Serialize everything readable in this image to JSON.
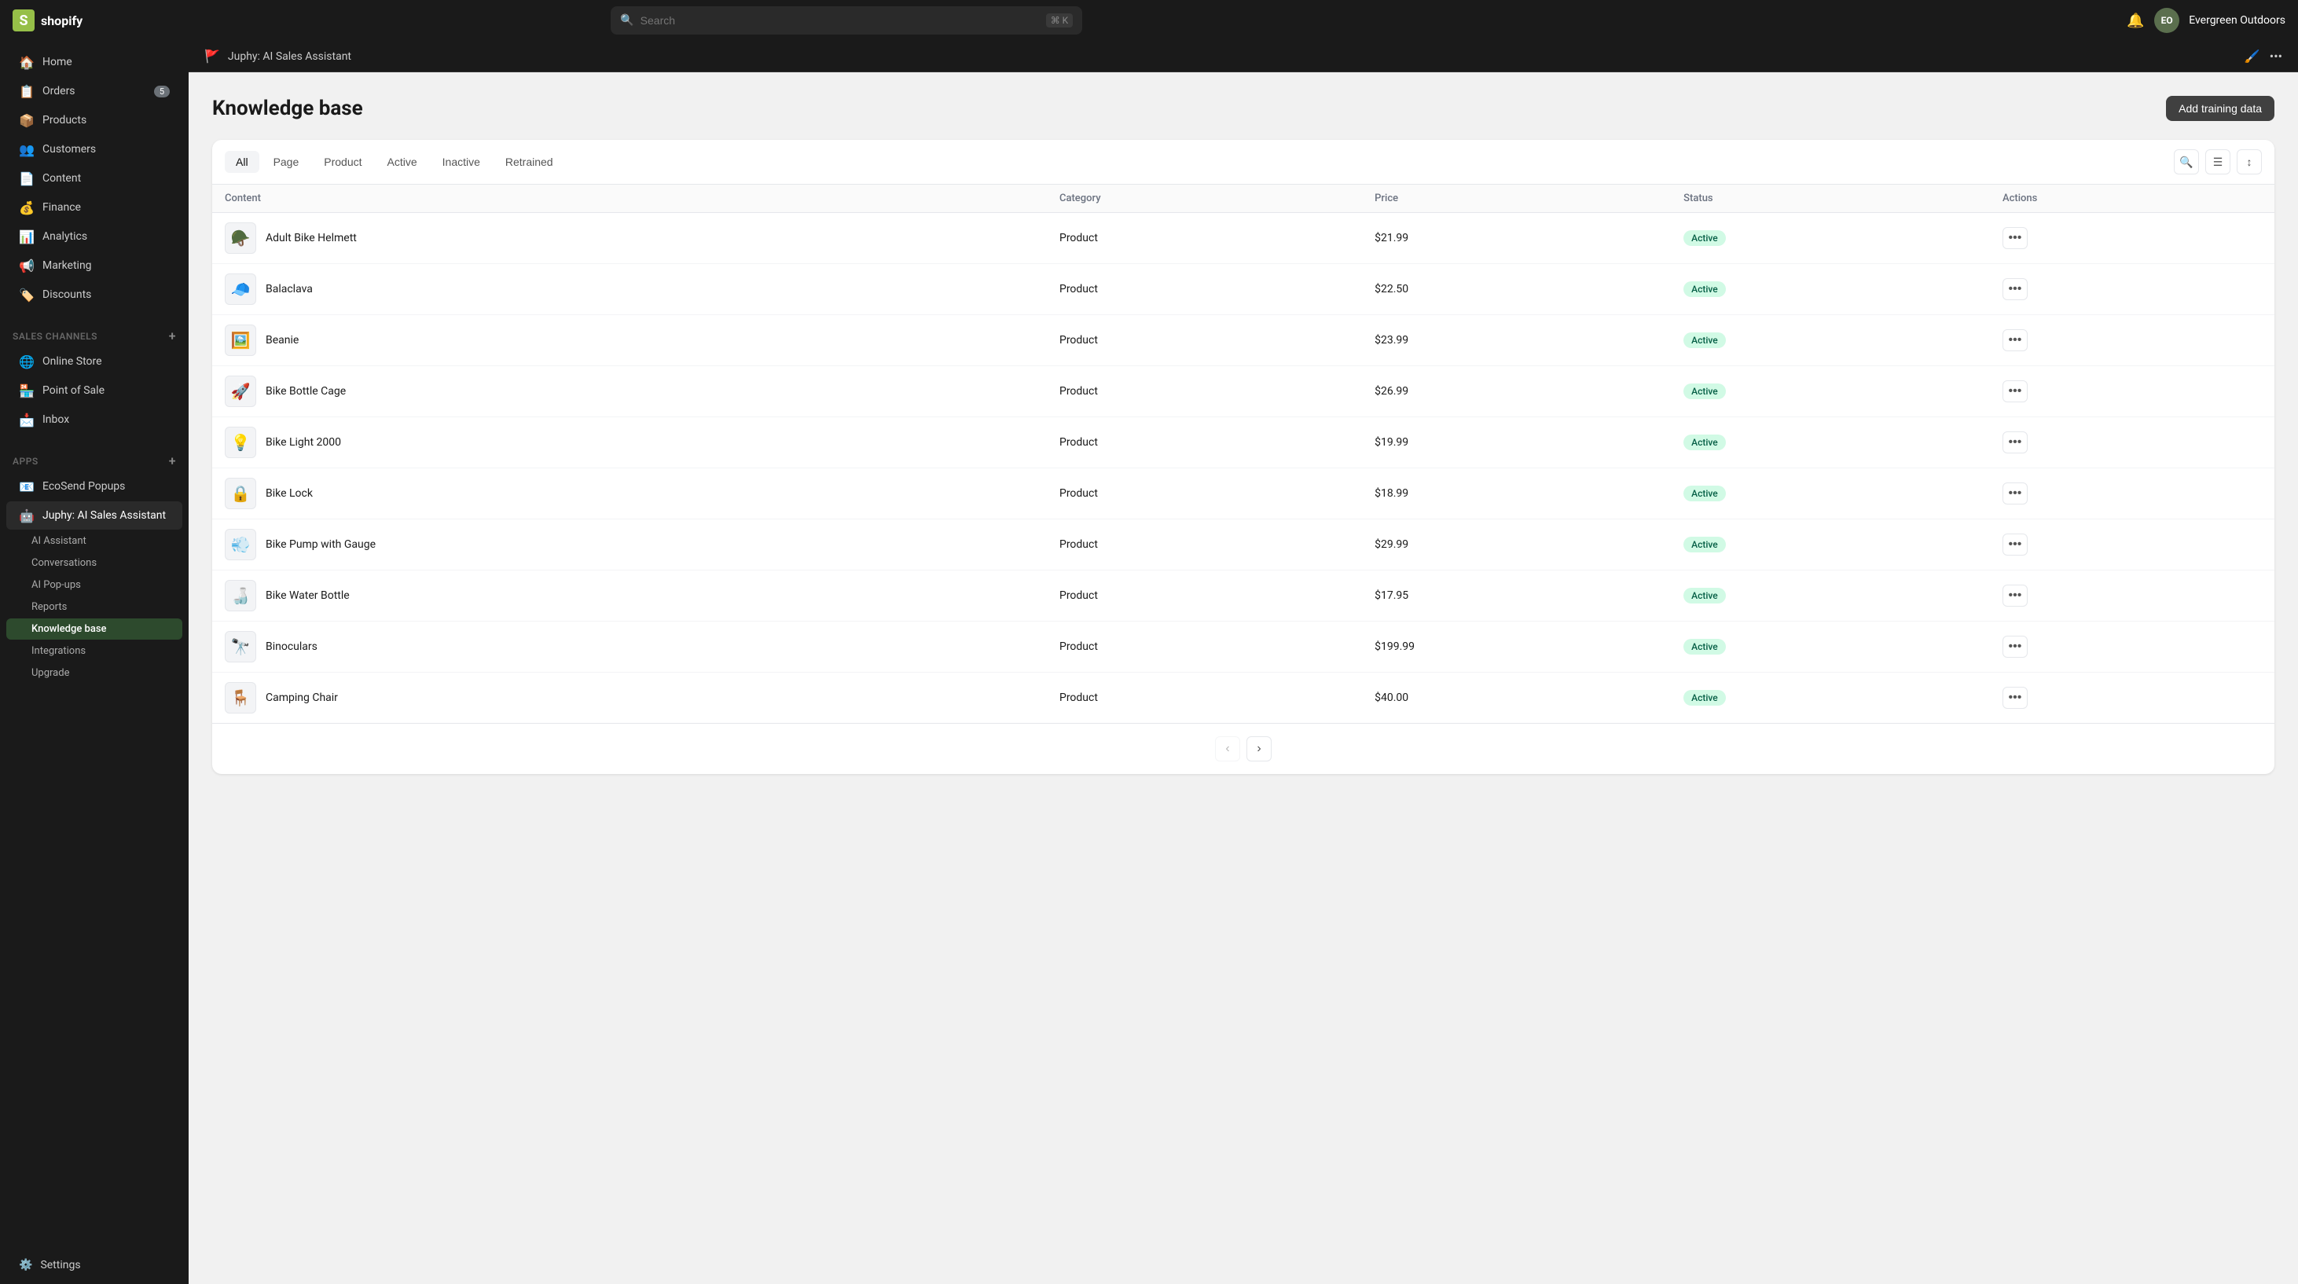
{
  "topbar": {
    "logo_text": "shopify",
    "search_placeholder": "Search",
    "search_shortcut": "⌘ K",
    "avatar_initials": "EO",
    "store_name": "Evergreen Outdoors"
  },
  "sidebar": {
    "main_items": [
      {
        "id": "home",
        "label": "Home",
        "icon": "🏠",
        "badge": null
      },
      {
        "id": "orders",
        "label": "Orders",
        "icon": "📋",
        "badge": "5"
      },
      {
        "id": "products",
        "label": "Products",
        "icon": "📦",
        "badge": null
      },
      {
        "id": "customers",
        "label": "Customers",
        "icon": "👥",
        "badge": null
      },
      {
        "id": "content",
        "label": "Content",
        "icon": "📄",
        "badge": null
      },
      {
        "id": "finance",
        "label": "Finance",
        "icon": "💰",
        "badge": null
      },
      {
        "id": "analytics",
        "label": "Analytics",
        "icon": "📊",
        "badge": null
      },
      {
        "id": "marketing",
        "label": "Marketing",
        "icon": "📢",
        "badge": null
      },
      {
        "id": "discounts",
        "label": "Discounts",
        "icon": "🏷️",
        "badge": null
      }
    ],
    "sales_channels_label": "Sales channels",
    "sales_channels": [
      {
        "id": "online-store",
        "label": "Online Store",
        "icon": "🌐"
      },
      {
        "id": "point-of-sale",
        "label": "Point of Sale",
        "icon": "🏪"
      },
      {
        "id": "inbox",
        "label": "Inbox",
        "icon": "📩"
      }
    ],
    "apps_label": "Apps",
    "apps": [
      {
        "id": "ecosend",
        "label": "EcoSend Popups",
        "icon": "📧"
      },
      {
        "id": "juphy",
        "label": "Juphy: AI Sales Assistant",
        "icon": "🤖",
        "active": true
      }
    ],
    "sub_items": [
      {
        "id": "ai-assistant",
        "label": "AI Assistant"
      },
      {
        "id": "conversations",
        "label": "Conversations"
      },
      {
        "id": "ai-pop-ups",
        "label": "AI Pop-ups"
      },
      {
        "id": "reports",
        "label": "Reports"
      },
      {
        "id": "knowledge-base",
        "label": "Knowledge base",
        "active": true
      },
      {
        "id": "integrations",
        "label": "Integrations"
      },
      {
        "id": "upgrade",
        "label": "Upgrade"
      }
    ],
    "settings_label": "Settings"
  },
  "breadcrumb": {
    "flag": "🚩",
    "text": "Juphy: AI Sales Assistant"
  },
  "page": {
    "title": "Knowledge base",
    "add_button": "Add training data"
  },
  "tabs": {
    "items": [
      {
        "id": "all",
        "label": "All",
        "active": true
      },
      {
        "id": "page",
        "label": "Page"
      },
      {
        "id": "product",
        "label": "Product"
      },
      {
        "id": "active",
        "label": "Active"
      },
      {
        "id": "inactive",
        "label": "Inactive"
      },
      {
        "id": "retrained",
        "label": "Retrained"
      }
    ]
  },
  "table": {
    "columns": [
      {
        "id": "content",
        "label": "Content"
      },
      {
        "id": "category",
        "label": "Category"
      },
      {
        "id": "price",
        "label": "Price"
      },
      {
        "id": "status",
        "label": "Status"
      },
      {
        "id": "actions",
        "label": "Actions"
      }
    ],
    "rows": [
      {
        "id": 1,
        "name": "Adult Bike Helmett",
        "icon": "🪖",
        "category": "Product",
        "price": "$21.99",
        "status": "Active"
      },
      {
        "id": 2,
        "name": "Balaclava",
        "icon": "🧢",
        "category": "Product",
        "price": "$22.50",
        "status": "Active"
      },
      {
        "id": 3,
        "name": "Beanie",
        "icon": "🖼️",
        "category": "Product",
        "price": "$23.99",
        "status": "Active"
      },
      {
        "id": 4,
        "name": "Bike Bottle Cage",
        "icon": "🚀",
        "category": "Product",
        "price": "$26.99",
        "status": "Active"
      },
      {
        "id": 5,
        "name": "Bike Light 2000",
        "icon": "💡",
        "category": "Product",
        "price": "$19.99",
        "status": "Active"
      },
      {
        "id": 6,
        "name": "Bike Lock",
        "icon": "🔒",
        "category": "Product",
        "price": "$18.99",
        "status": "Active"
      },
      {
        "id": 7,
        "name": "Bike Pump with Gauge",
        "icon": "💨",
        "category": "Product",
        "price": "$29.99",
        "status": "Active"
      },
      {
        "id": 8,
        "name": "Bike Water Bottle",
        "icon": "🍶",
        "category": "Product",
        "price": "$17.95",
        "status": "Active"
      },
      {
        "id": 9,
        "name": "Binoculars",
        "icon": "🔭",
        "category": "Product",
        "price": "$199.99",
        "status": "Active"
      },
      {
        "id": 10,
        "name": "Camping Chair",
        "icon": "🪑",
        "category": "Product",
        "price": "$40.00",
        "status": "Active"
      }
    ],
    "status_active_label": "Active"
  },
  "pagination": {
    "prev_icon": "‹",
    "next_icon": "›"
  }
}
